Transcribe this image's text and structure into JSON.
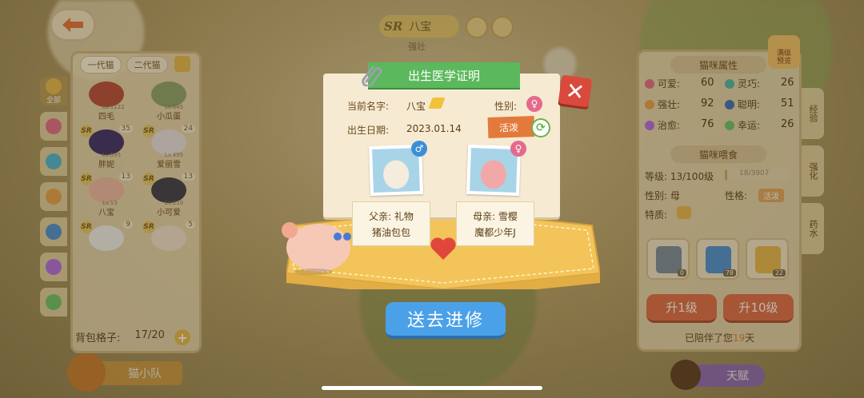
{
  "header": {
    "rarity": "SR",
    "cat_name": "八宝",
    "cat_trait_sub": "强壮"
  },
  "left_panel": {
    "tabs": [
      "一代猫",
      "二代猫"
    ],
    "side_tabs": [
      {
        "label": "全部",
        "color": "#e9b94c"
      },
      {
        "label": "",
        "color": "#e46a8c"
      },
      {
        "label": "",
        "color": "#4ab7d8"
      },
      {
        "label": "",
        "color": "#e9a14c"
      },
      {
        "label": "",
        "color": "#4a8fd8"
      },
      {
        "label": "",
        "color": "#b36ae6"
      },
      {
        "label": "",
        "color": "#6bc36a"
      }
    ],
    "cats": [
      {
        "name": "四毛",
        "level": "Lv.1122",
        "sr": "",
        "num": "",
        "color": "#b84a3a"
      },
      {
        "name": "小瓜蛋",
        "level": "Lv.645",
        "sr": "",
        "num": "",
        "color": "#8aa36a"
      },
      {
        "name": "胖妮",
        "level": "Lv.595",
        "sr": "SR",
        "num": "35",
        "color": "#3a2a6a"
      },
      {
        "name": "爱丽雪",
        "level": "Lv.495",
        "sr": "SR",
        "num": "24",
        "color": "#e8e2e6"
      },
      {
        "name": "八宝",
        "level": "Lv.13",
        "sr": "SR",
        "num": "13",
        "color": "#f2b8a8"
      },
      {
        "name": "小可爱",
        "level": "Lv.210",
        "sr": "SR",
        "num": "13",
        "color": "#3a3a4a"
      },
      {
        "name": "",
        "level": "",
        "sr": "SR",
        "num": "9",
        "color": "#f2f2f2"
      },
      {
        "name": "",
        "level": "",
        "sr": "SR",
        "num": "5",
        "color": "#f2e2d2"
      }
    ],
    "bag_label": "背包格子:",
    "bag_value": "17/20",
    "team_label": "猫小队"
  },
  "certificate": {
    "title": "出生医学证明",
    "name_label": "当前名字:",
    "name_value": "八宝",
    "gender_label": "性别:",
    "birth_label": "出生日期:",
    "birth_value": "2023.01.14",
    "trait": "活泼",
    "father_label": "父亲: 礼物",
    "father_owner": "猪油包包",
    "mother_label": "母亲: 雪樱",
    "mother_owner": "魔都少年J",
    "send_button": "送去进修"
  },
  "right_panel": {
    "attr_title": "猫咪属性",
    "attrs": [
      {
        "label": "可爱:",
        "value": "60",
        "color": "#e46a8c"
      },
      {
        "label": "灵巧:",
        "value": "26",
        "color": "#4ab7a8"
      },
      {
        "label": "强壮:",
        "value": "92",
        "color": "#e9a14c"
      },
      {
        "label": "聪明:",
        "value": "51",
        "color": "#3a6fb8"
      },
      {
        "label": "治愈:",
        "value": "76",
        "color": "#b36ae6"
      },
      {
        "label": "幸运:",
        "value": "26",
        "color": "#6bc36a"
      }
    ],
    "feed_title": "猫咪喂食",
    "level_label": "等级: 13/100级",
    "exp_text": "18/3907",
    "exp_fraction": 0.04,
    "gender_label": "性别: 母",
    "personality_label": "性格:",
    "personality_value": "活泼",
    "special_label": "特质:",
    "foods": [
      {
        "count": "0",
        "color": "#7a8aa0"
      },
      {
        "count": "78",
        "color": "#4a8fd8"
      },
      {
        "count": "22",
        "color": "#e9b94c"
      }
    ],
    "up1": "升1级",
    "up10": "升10级",
    "accompany_prefix": "已陪伴了您",
    "accompany_days": "19",
    "accompany_suffix": "天",
    "side_tabs": [
      "经验",
      "强化",
      "药水"
    ],
    "preview_label": "满级\n预览",
    "talent_label": "天赋"
  }
}
